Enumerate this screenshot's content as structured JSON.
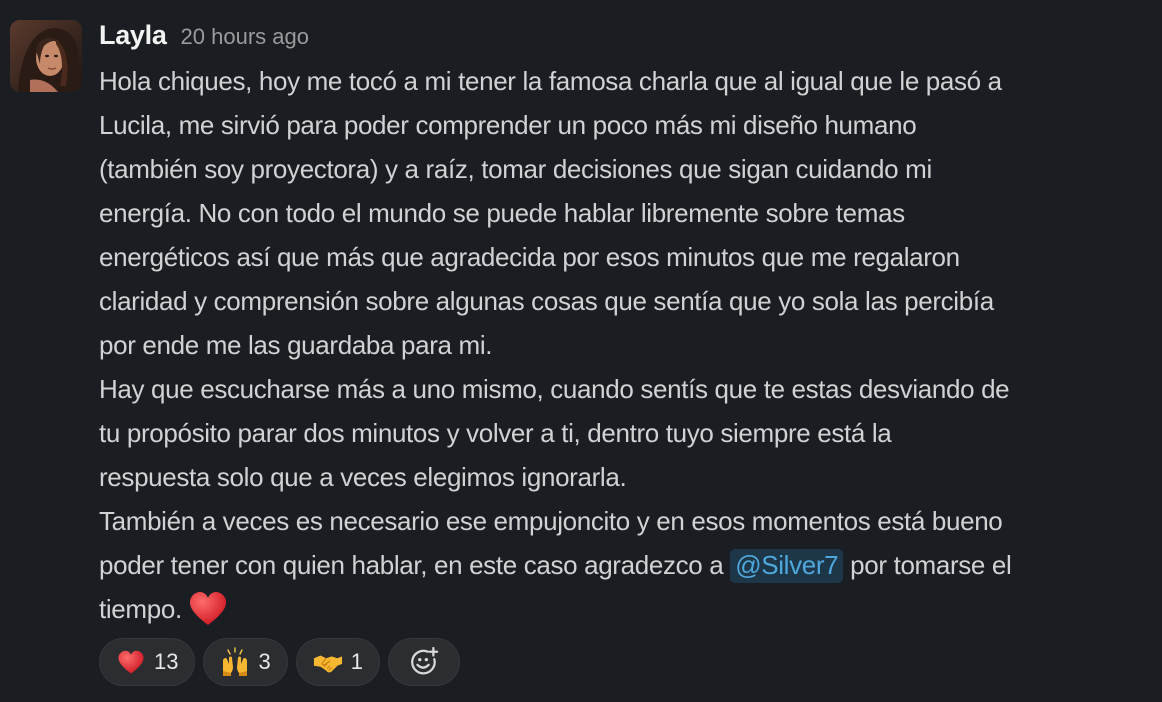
{
  "message": {
    "author": "Layla",
    "timestamp": "20 hours ago",
    "lines": [
      "Hola chiques, hoy me tocó a mi tener la famosa charla que al igual que le pasó a",
      "Lucila, me sirvió para poder comprender un poco más mi diseño humano",
      "(también soy proyectora) y a raíz, tomar decisiones que sigan cuidando mi",
      "energía. No con todo el mundo se puede hablar libremente sobre temas",
      "energéticos así que más que agradecida por esos minutos que me regalaron",
      "claridad y comprensión sobre algunas cosas que sentía que yo sola las percibía",
      "por ende me las guardaba para mi.",
      "Hay que escucharse más a uno mismo, cuando sentís que te estas desviando de",
      "tu propósito parar dos minutos y volver a ti, dentro tuyo siempre está la",
      "respuesta solo que a veces elegimos ignorarla.",
      "También a veces es necesario ese empujoncito y en esos momentos está bueno"
    ],
    "mention_line_before": "poder tener con quien hablar, en este caso agradezco a ",
    "mention": "@Silver7",
    "mention_line_after": " por tomarse el",
    "last_line": "tiempo.",
    "end_emoji": "heart-emoji"
  },
  "reactions": [
    {
      "emoji": "heart-emoji",
      "count": "13"
    },
    {
      "emoji": "raised-hands-emoji",
      "count": "3"
    },
    {
      "emoji": "handshake-emoji",
      "count": "1"
    }
  ],
  "add_reaction_icon": "add-reaction-icon",
  "colors": {
    "background": "#1a1d21",
    "text": "#d1d2d3",
    "mention": "#4ea7dd",
    "mention_bg": "#1d3748",
    "reaction_bg": "#2b2d31"
  }
}
